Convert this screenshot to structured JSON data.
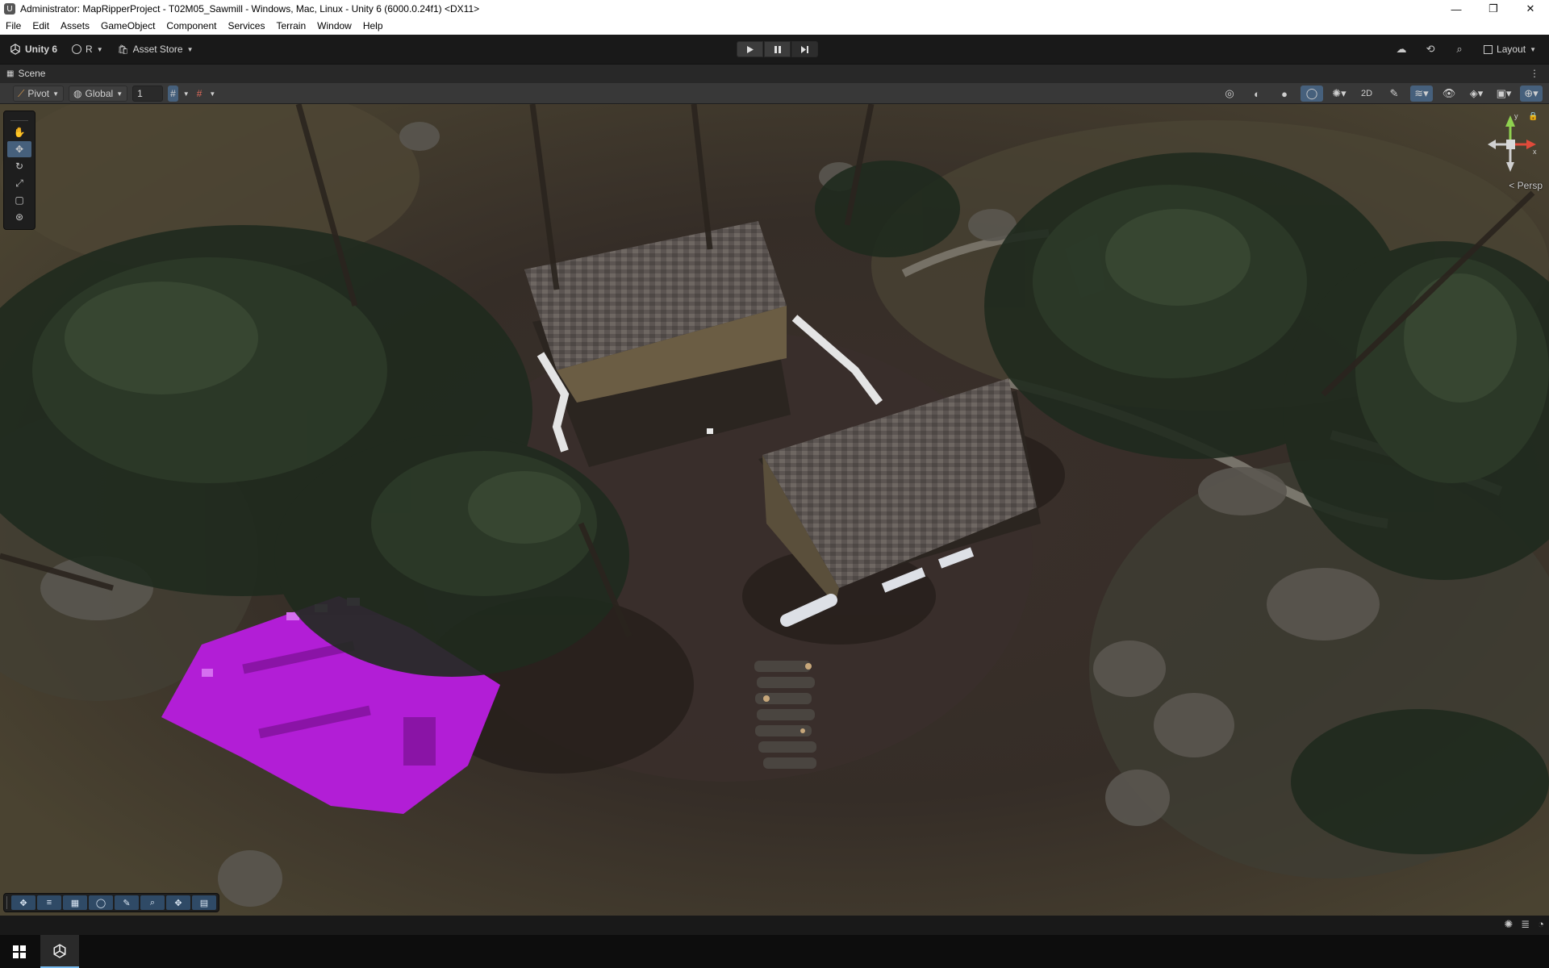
{
  "window": {
    "title": "Administrator: MapRipperProject - T02M05_Sawmill - Windows, Mac, Linux - Unity 6 (6000.0.24f1) <DX11>",
    "minimize_glyph": "—",
    "maximize_glyph": "❐",
    "close_glyph": "✕"
  },
  "menubar": {
    "items": [
      "File",
      "Edit",
      "Assets",
      "GameObject",
      "Component",
      "Services",
      "Terrain",
      "Window",
      "Help"
    ]
  },
  "toolbar": {
    "unity_label": "Unity 6",
    "account_label": "R",
    "asset_store_label": "Asset Store",
    "layout_label": "Layout",
    "play_icon": "play-icon",
    "pause_icon": "pause-icon",
    "step_icon": "step-icon"
  },
  "scene_tab": {
    "label": "Scene",
    "menu_glyph": "⋮"
  },
  "scene_toolbar": {
    "pivot_label": "Pivot",
    "global_label": "Global",
    "grid_increment": "1"
  },
  "viewport": {
    "camera_mode": "< Persp",
    "axis_labels": {
      "x": "x",
      "y": "y"
    }
  },
  "taskbar": {
    "apps": [
      "Unity"
    ]
  },
  "colors": {
    "accent_active": "#46607c",
    "missing_material_magenta": "#b21ed6",
    "toolbar_bg": "#191919"
  }
}
